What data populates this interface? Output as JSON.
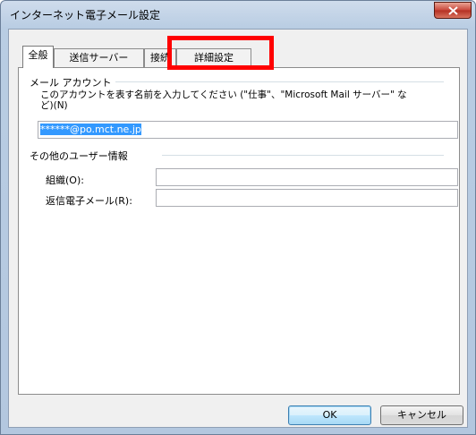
{
  "window": {
    "title": "インターネット電子メール設定"
  },
  "tabs": [
    {
      "label": "全般",
      "active": true
    },
    {
      "label": "送信サーバー",
      "active": false
    },
    {
      "label": "接続",
      "active": false
    },
    {
      "label": "詳細設定",
      "active": false
    }
  ],
  "mail_account": {
    "group_label": "メール アカウント",
    "description_line1": "このアカウントを表す名前を入力してください (\"仕事\"、\"Microsoft Mail サーバー\" な",
    "description_line2": "ど)(N)",
    "account_name_value": "******@po.mct.ne.jp"
  },
  "user_info": {
    "group_label": "その他のユーザー情報",
    "organization_label": "組織(O):",
    "organization_value": "",
    "reply_email_label": "返信電子メール(R):",
    "reply_email_value": ""
  },
  "buttons": {
    "ok_label": "OK",
    "cancel_label": "キャンセル"
  },
  "colors": {
    "highlight": "#ff0000",
    "selection": "#3399ff"
  }
}
